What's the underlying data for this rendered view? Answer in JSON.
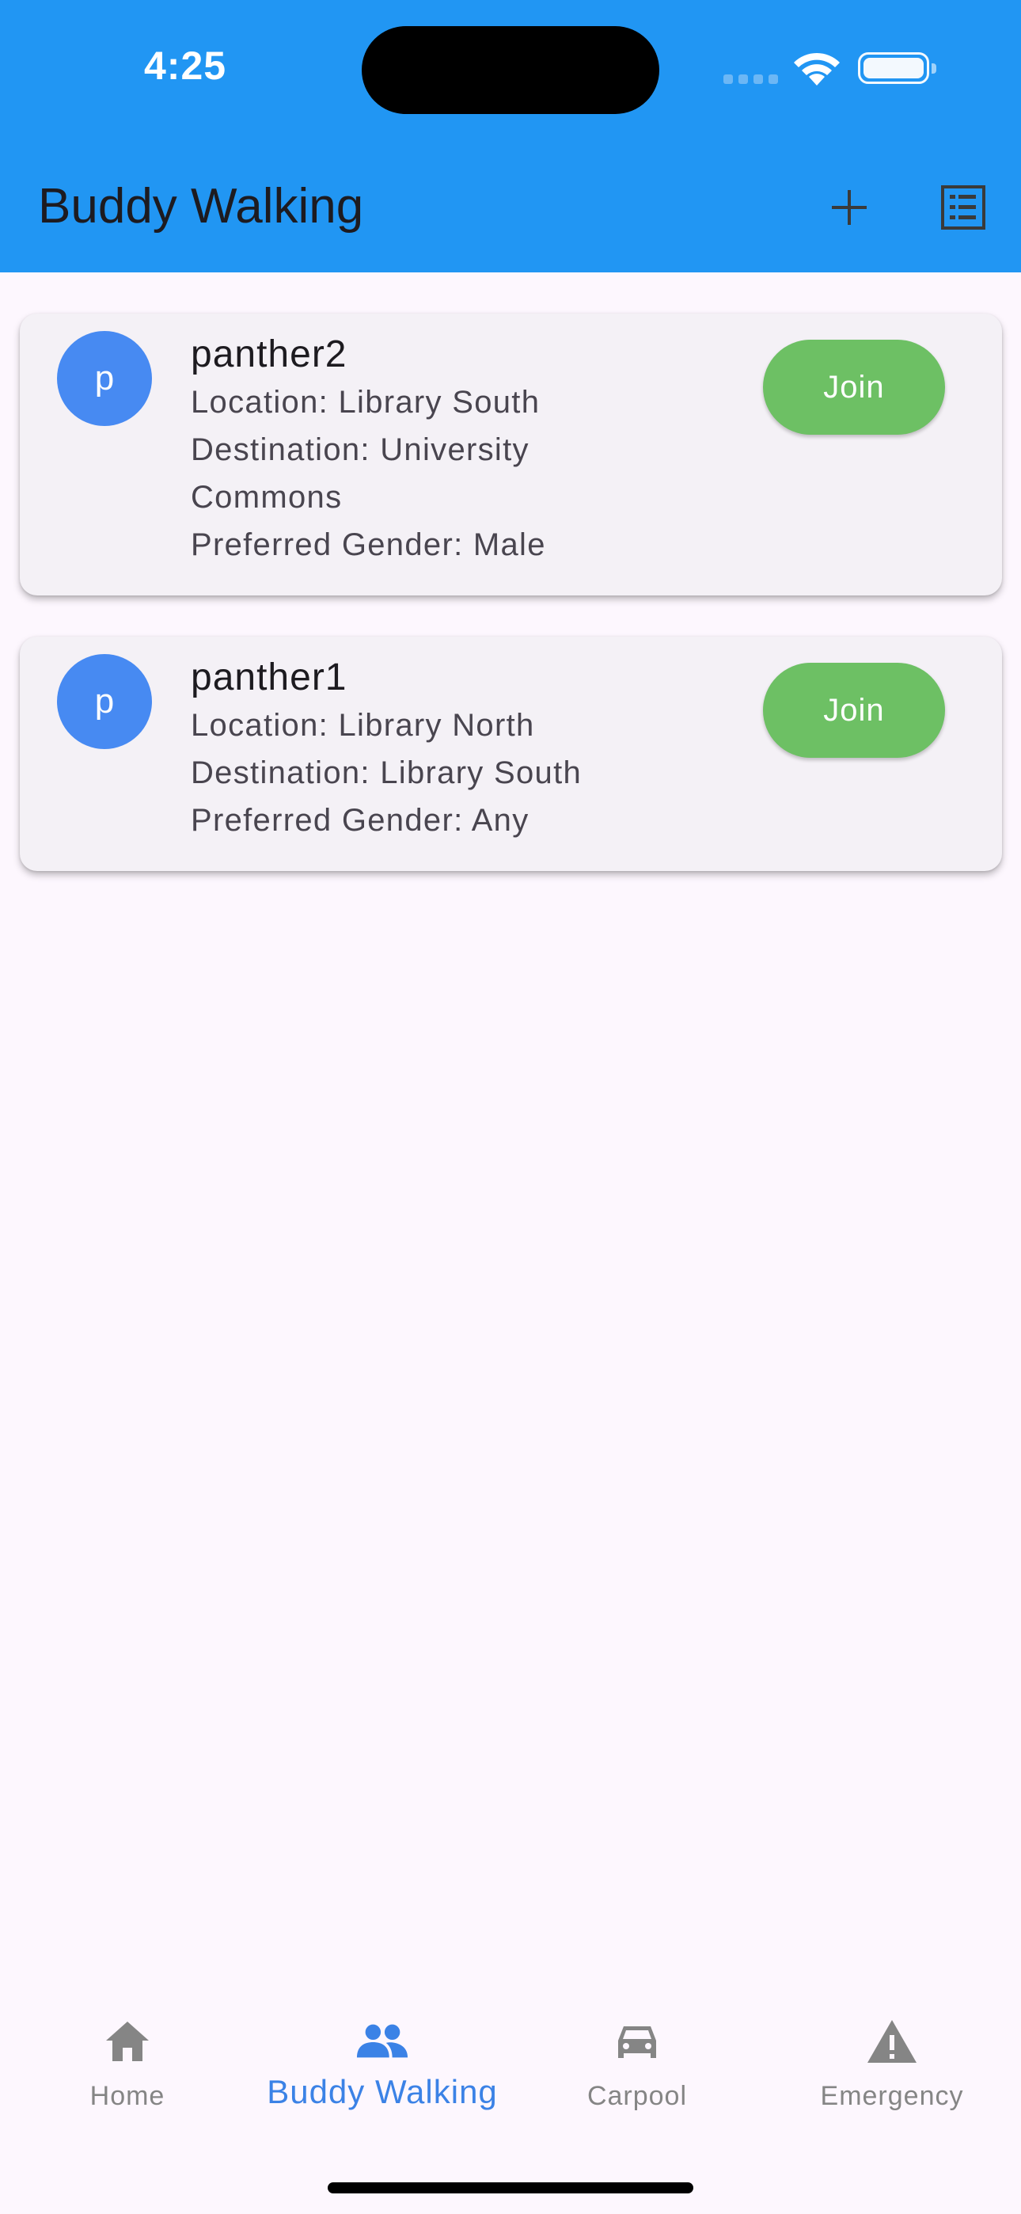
{
  "status_bar": {
    "time": "4:25"
  },
  "app_bar": {
    "title": "Buddy Walking",
    "actions": [
      {
        "icon": "add-icon"
      },
      {
        "icon": "list-icon"
      }
    ]
  },
  "walks": [
    {
      "avatar_letter": "p",
      "username": "panther2",
      "location": "Location: Library South",
      "destination_line1": "Destination: University",
      "destination_line2": "Commons",
      "preferred_gender": "Preferred Gender: Male",
      "join_label": "Join"
    },
    {
      "avatar_letter": "p",
      "username": "panther1",
      "location": "Location: Library North",
      "destination_line1": "Destination: Library South",
      "preferred_gender": "Preferred Gender: Any",
      "join_label": "Join"
    }
  ],
  "bottom_nav": {
    "items": [
      {
        "label": "Home",
        "icon": "home-icon",
        "active": false
      },
      {
        "label": "Buddy Walking",
        "icon": "people-icon",
        "active": true
      },
      {
        "label": "Carpool",
        "icon": "car-icon",
        "active": false
      },
      {
        "label": "Emergency",
        "icon": "warning-icon",
        "active": false
      }
    ]
  },
  "colors": {
    "app_bar": "#2196f3",
    "background": "#fdf7fe",
    "card": "#f4f1f6",
    "avatar": "#478af2",
    "join_button": "#6dc064",
    "nav_active": "#3b82e6",
    "nav_inactive": "#858585"
  }
}
